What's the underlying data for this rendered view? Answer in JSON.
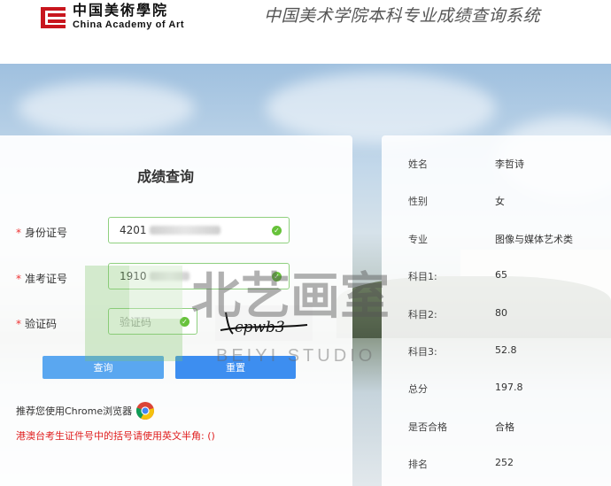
{
  "header": {
    "logo_cn": "中国美術學院",
    "logo_en": "China Academy of Art",
    "site_title": "中国美术学院本科专业成绩查询系统"
  },
  "form": {
    "title": "成绩查询",
    "fields": [
      {
        "label": "身份证号",
        "value": "4201",
        "placeholder": ""
      },
      {
        "label": "准考证号",
        "value": "1910",
        "placeholder": ""
      },
      {
        "label": "验证码",
        "value": "",
        "placeholder": "验证码"
      }
    ],
    "captcha_text": "cpwb3",
    "buttons": {
      "query": "查询",
      "reset": "重置"
    },
    "chrome_tip": "推荐您使用Chrome浏览器",
    "hk_tip": "港澳台考生证件号中的括号请使用英文半角: ()"
  },
  "result": {
    "rows": [
      {
        "label": "姓名",
        "value": "李哲诗"
      },
      {
        "label": "性别",
        "value": "女"
      },
      {
        "label": "专业",
        "value": "图像与媒体艺术类"
      },
      {
        "label": "科目1:",
        "value": "65"
      },
      {
        "label": "科目2:",
        "value": "80"
      },
      {
        "label": "科目3:",
        "value": "52.8"
      },
      {
        "label": "总分",
        "value": "197.8"
      },
      {
        "label": "是否合格",
        "value": "合格"
      },
      {
        "label": "排名",
        "value": "252"
      }
    ]
  },
  "watermark": {
    "cn": "北艺画室",
    "en": "BEIYI STUDIO"
  },
  "colors": {
    "brand_red": "#c8161e",
    "valid_green": "#67c23a",
    "button_blue": "#3d8ef0",
    "warn_red": "#e02020"
  }
}
